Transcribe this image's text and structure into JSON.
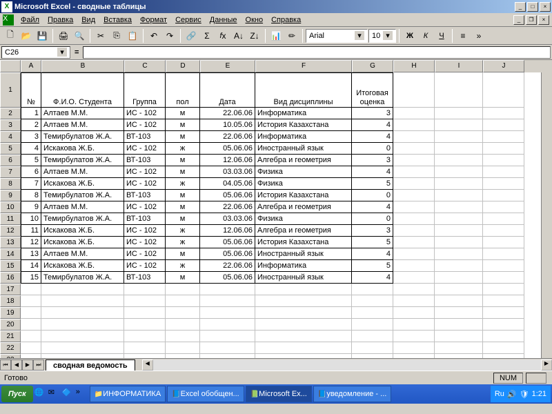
{
  "title": "Microsoft Excel - сводные таблицы",
  "menu": [
    "Файл",
    "Правка",
    "Вид",
    "Вставка",
    "Формат",
    "Сервис",
    "Данные",
    "Окно",
    "Справка"
  ],
  "font": {
    "name": "Arial",
    "size": "10"
  },
  "namebox": "C26",
  "cols": [
    "A",
    "B",
    "C",
    "D",
    "E",
    "F",
    "G",
    "H",
    "I",
    "J"
  ],
  "headers": {
    "A": "№",
    "B": "Ф.И.О. Студента",
    "C": "Группа",
    "D": "пол",
    "E": "Дата",
    "F": "Вид дисциплины",
    "G": "Итоговая оценка"
  },
  "rows": [
    {
      "n": 1,
      "fio": "Алтаев М.М.",
      "grp": "ИС - 102",
      "sex": "м",
      "date": "22.06.06",
      "disc": "Информатика",
      "gr": 3
    },
    {
      "n": 2,
      "fio": "Алтаев М.М.",
      "grp": "ИС - 102",
      "sex": "м",
      "date": "10.05.06",
      "disc": "История Казахстана",
      "gr": 4
    },
    {
      "n": 3,
      "fio": "Темирбулатов Ж.А.",
      "grp": "ВТ-103",
      "sex": "м",
      "date": "22.06.06",
      "disc": "Информатика",
      "gr": 4
    },
    {
      "n": 4,
      "fio": "Искакова Ж.Б.",
      "grp": "ИС - 102",
      "sex": "ж",
      "date": "05.06.06",
      "disc": "Иностранный язык",
      "gr": 0
    },
    {
      "n": 5,
      "fio": "Темирбулатов Ж.А.",
      "grp": "ВТ-103",
      "sex": "м",
      "date": "12.06.06",
      "disc": "Алгебра и геометрия",
      "gr": 3
    },
    {
      "n": 6,
      "fio": "Алтаев М.М.",
      "grp": "ИС - 102",
      "sex": "м",
      "date": "03.03.06",
      "disc": "Физика",
      "gr": 4
    },
    {
      "n": 7,
      "fio": "Искакова Ж.Б.",
      "grp": "ИС - 102",
      "sex": "ж",
      "date": "04.05.06",
      "disc": "Физика",
      "gr": 5
    },
    {
      "n": 8,
      "fio": "Темирбулатов Ж.А.",
      "grp": "ВТ-103",
      "sex": "м",
      "date": "05.06.06",
      "disc": "История Казахстана",
      "gr": 0
    },
    {
      "n": 9,
      "fio": "Алтаев М.М.",
      "grp": "ИС - 102",
      "sex": "м",
      "date": "22.06.06",
      "disc": "Алгебра и геометрия",
      "gr": 4
    },
    {
      "n": 10,
      "fio": "Темирбулатов Ж.А.",
      "grp": "ВТ-103",
      "sex": "м",
      "date": "03.03.06",
      "disc": "Физика",
      "gr": 0
    },
    {
      "n": 11,
      "fio": "Искакова Ж.Б.",
      "grp": "ИС - 102",
      "sex": "ж",
      "date": "12.06.06",
      "disc": "Алгебра и геометрия",
      "gr": 3
    },
    {
      "n": 12,
      "fio": "Искакова Ж.Б.",
      "grp": "ИС - 102",
      "sex": "ж",
      "date": "05.06.06",
      "disc": "История Казахстана",
      "gr": 5
    },
    {
      "n": 13,
      "fio": "Алтаев М.М.",
      "grp": "ИС - 102",
      "sex": "м",
      "date": "05.06.06",
      "disc": "Иностранный язык",
      "gr": 4
    },
    {
      "n": 14,
      "fio": "Искакова Ж.Б.",
      "grp": "ИС - 102",
      "sex": "ж",
      "date": "22.06.06",
      "disc": "Информатика",
      "gr": 5
    },
    {
      "n": 15,
      "fio": "Темирбулатов Ж.А.",
      "grp": "ВТ-103",
      "sex": "м",
      "date": "05.06.06",
      "disc": "Иностранный язык",
      "gr": 4
    }
  ],
  "sheettab": "сводная ведомость",
  "status": "Готово",
  "numind": "NUM",
  "taskbar": {
    "start": "Пуск",
    "items": [
      "ИНФОРМАТИКА",
      "Excel обобщен...",
      "Microsoft Ex...",
      "уведомление - ..."
    ],
    "lang": "Ru",
    "time": "1:21"
  }
}
